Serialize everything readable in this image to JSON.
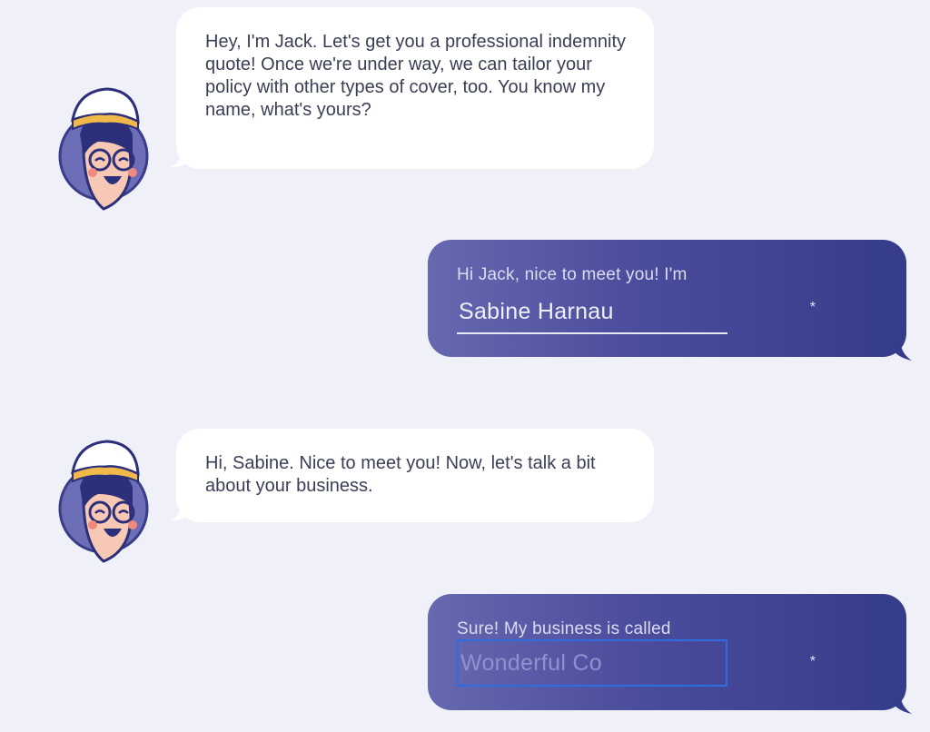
{
  "conversation": {
    "bot_message_1": "Hey, I'm Jack. Let's get you a professional indemnity quote! Once we're under way, we can tailor your policy with other types of cover, too. You know my name, what's yours?",
    "user_reply_1": {
      "prompt": "Hi Jack, nice to meet you! I'm",
      "value": "Sabine Harnau",
      "required_mark": "*"
    },
    "bot_message_2": "Hi, Sabine. Nice to meet you! Now, let's talk a bit about your business.",
    "user_reply_2": {
      "prompt": "Sure! My business is called",
      "value": "Wonderful Co",
      "required_mark": "*"
    }
  },
  "icons": {
    "avatar": "jack-sailor-avatar-icon"
  },
  "colors": {
    "background": "#f0f1f8",
    "bot_bubble": "#ffffff",
    "user_bubble_start": "#6668b0",
    "user_bubble_end": "#353c8a",
    "focus_outline": "#2f6ce0"
  }
}
